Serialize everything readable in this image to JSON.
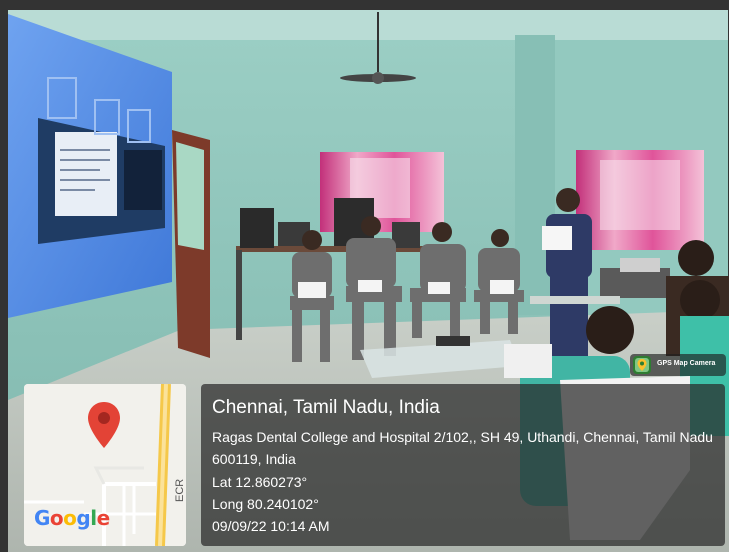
{
  "location": {
    "title": "Chennai, Tamil Nadu, India",
    "address": "Ragas Dental College and Hospital 2/102,, SH 49, Uthandi, Chennai, Tamil Nadu 600119, India",
    "latitude": "Lat 12.860273°",
    "longitude": "Long 80.240102°",
    "datetime": "09/09/22 10:14 AM"
  },
  "map": {
    "logo": "Google",
    "road_label": "ECR",
    "pin_color": "#e34336"
  },
  "badge": {
    "label": "GPS Map Camera",
    "icon": "gps-map-camera-icon"
  },
  "colors": {
    "wall": "#8fc7bd",
    "projection": "#5b8fe0",
    "curtain": "#d63f8a",
    "scrubs": "#6e6e6e"
  }
}
